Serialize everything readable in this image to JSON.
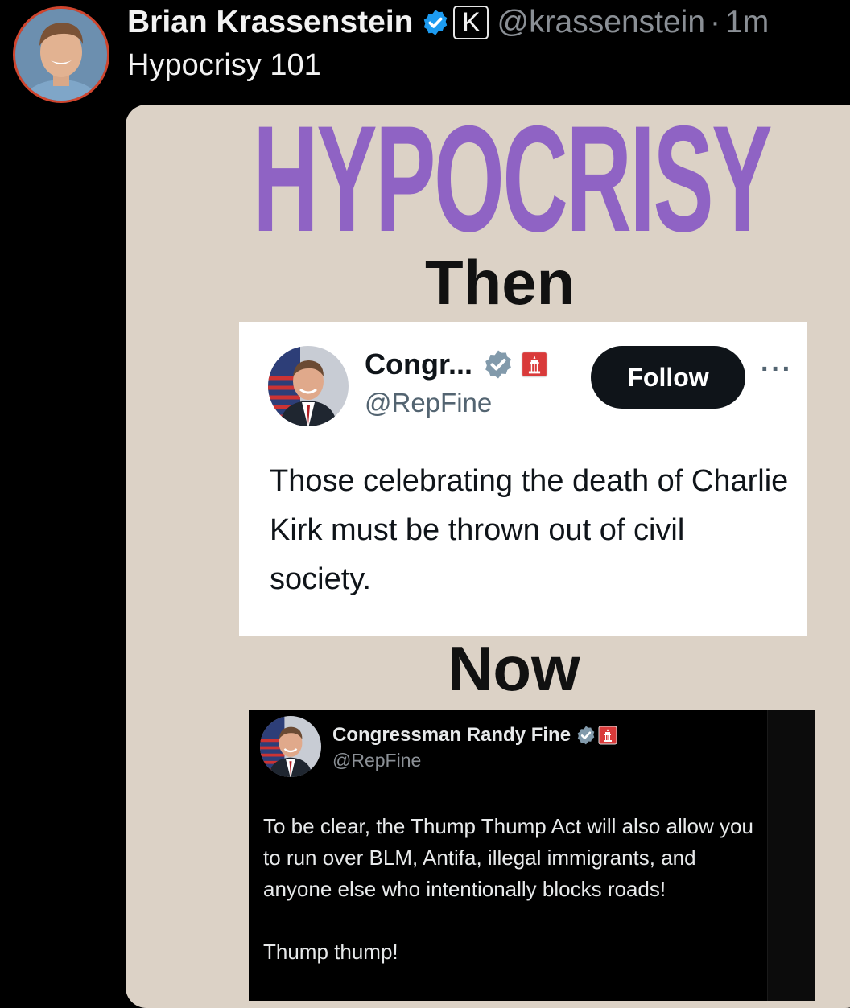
{
  "post": {
    "author_name": "Brian Krassenstein",
    "affiliation_letter": "K",
    "handle": "@krassenstein",
    "separator": "·",
    "time": "1m",
    "text": "Hypocrisy 101"
  },
  "media": {
    "headline": "HYPOCRISY",
    "then_label": "Then",
    "now_label": "Now",
    "then_tweet": {
      "name": "Congr...",
      "handle": "@RepFine",
      "follow_label": "Follow",
      "more_label": "···",
      "body": "Those celebrating the death of Charlie Kirk must be thrown out of civil society."
    },
    "now_tweet": {
      "name": "Congressman Randy Fine",
      "handle": "@RepFine",
      "body_line1": "To be clear, the Thump Thump Act will also allow you to run over BLM, Antifa, illegal immigrants, and anyone else who intentionally blocks roads!",
      "body_line2": "Thump thump!"
    }
  },
  "colors": {
    "background": "#000000",
    "card_beige": "#dcd2c6",
    "headline_purple": "#8f63c4",
    "verified_blue": "#1d9bf0",
    "gov_badge_grey": "#829aab",
    "capitol_red": "#d93a3a"
  },
  "icons": [
    "verified-badge-icon",
    "affiliation-badge-icon",
    "gov-verified-icon",
    "capitol-badge-icon",
    "more-icon"
  ]
}
